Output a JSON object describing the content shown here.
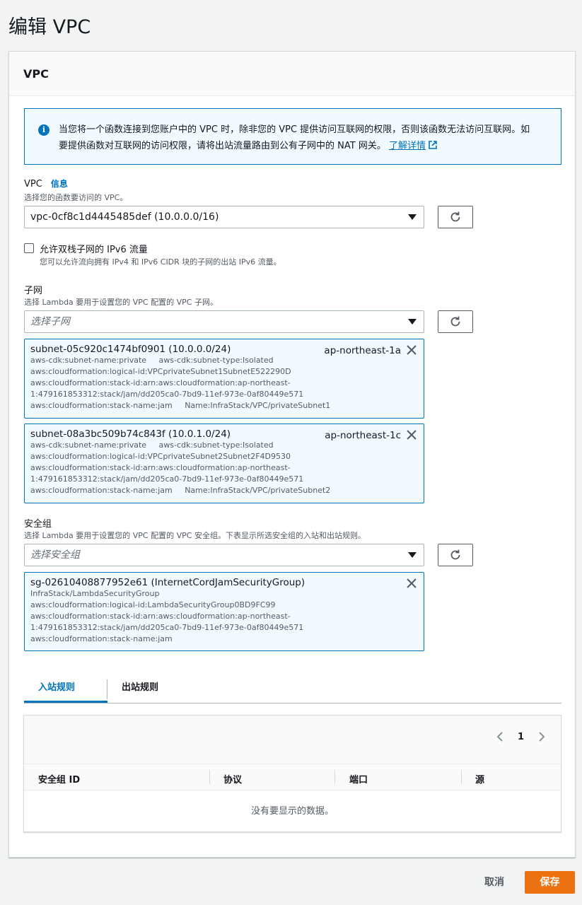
{
  "page": {
    "title": "编辑 VPC"
  },
  "panel": {
    "title": "VPC"
  },
  "info_alert": {
    "text": "当您将一个函数连接到您账户中的 VPC 时，除非您的 VPC 提供访问互联网的权限，否则该函数无法访问互联网。如要提供函数对互联网的访问权限，请将出站流量路由到公有子网中的 NAT 网关。",
    "link": "了解详情"
  },
  "vpc": {
    "label": "VPC",
    "info_link": "信息",
    "description": "选择您的函数要访问的 VPC。",
    "selected": "vpc-0cf8c1d4445485def (10.0.0.0/16)"
  },
  "ipv6": {
    "label": "允许双栈子网的 IPv6 流量",
    "description": "您可以允许流向拥有 IPv4 和 IPv6 CIDR 块的子网的出站 IPv6 流量。"
  },
  "subnets": {
    "label": "子网",
    "description": "选择 Lambda 要用于设置您的 VPC 配置的 VPC 子网。",
    "placeholder": "选择子网",
    "tokens": [
      {
        "title": "subnet-05c920c1474bf0901 (10.0.0.0/24)",
        "az": "ap-northeast-1a",
        "tags": [
          "aws-cdk:subnet-name:private     aws-cdk:subnet-type:Isolated",
          "aws:cloudformation:logical-id:VPCprivateSubnet1SubnetE522290D",
          "aws:cloudformation:stack-id:arn:aws:cloudformation:ap-northeast-",
          "1:479161853312:stack/jam/dd205ca0-7bd9-11ef-973e-0af80449e571",
          "aws:cloudformation:stack-name:jam     Name:InfraStack/VPC/privateSubnet1"
        ]
      },
      {
        "title": "subnet-08a3bc509b74c843f (10.0.1.0/24)",
        "az": "ap-northeast-1c",
        "tags": [
          "aws-cdk:subnet-name:private     aws-cdk:subnet-type:Isolated",
          "aws:cloudformation:logical-id:VPCprivateSubnet2Subnet2F4D9530",
          "aws:cloudformation:stack-id:arn:aws:cloudformation:ap-northeast-",
          "1:479161853312:stack/jam/dd205ca0-7bd9-11ef-973e-0af80449e571",
          "aws:cloudformation:stack-name:jam     Name:InfraStack/VPC/privateSubnet2"
        ]
      }
    ]
  },
  "security_groups": {
    "label": "安全组",
    "description": "选择 Lambda 要用于设置您的 VPC 配置的 VPC 安全组。下表显示所选安全组的入站和出站规则。",
    "placeholder": "选择安全组",
    "tokens": [
      {
        "title": "sg-02610408877952e61 (InternetCordJamSecurityGroup)",
        "tags": [
          "InfraStack/LambdaSecurityGroup",
          "aws:cloudformation:logical-id:LambdaSecurityGroup0BD9FC99",
          "aws:cloudformation:stack-id:arn:aws:cloudformation:ap-northeast-",
          "1:479161853312:stack/jam/dd205ca0-7bd9-11ef-973e-0af80449e571",
          "aws:cloudformation:stack-name:jam"
        ]
      }
    ]
  },
  "tabs": {
    "inbound": "入站规则",
    "outbound": "出站规则"
  },
  "rules_table": {
    "page": "1",
    "columns": [
      "安全组 ID",
      "协议",
      "端口",
      "源"
    ],
    "empty": "没有要显示的数据。"
  },
  "actions": {
    "cancel": "取消",
    "save": "保存"
  },
  "colors": {
    "accent": "#0073bb",
    "primary_button": "#ec7211",
    "info_bg": "#f1faff"
  },
  "icons": {
    "info": "info-icon",
    "external": "external-link-icon",
    "caret": "caret-down-icon",
    "refresh": "refresh-icon",
    "close": "close-icon",
    "prev": "chevron-left-icon",
    "next": "chevron-right-icon"
  }
}
